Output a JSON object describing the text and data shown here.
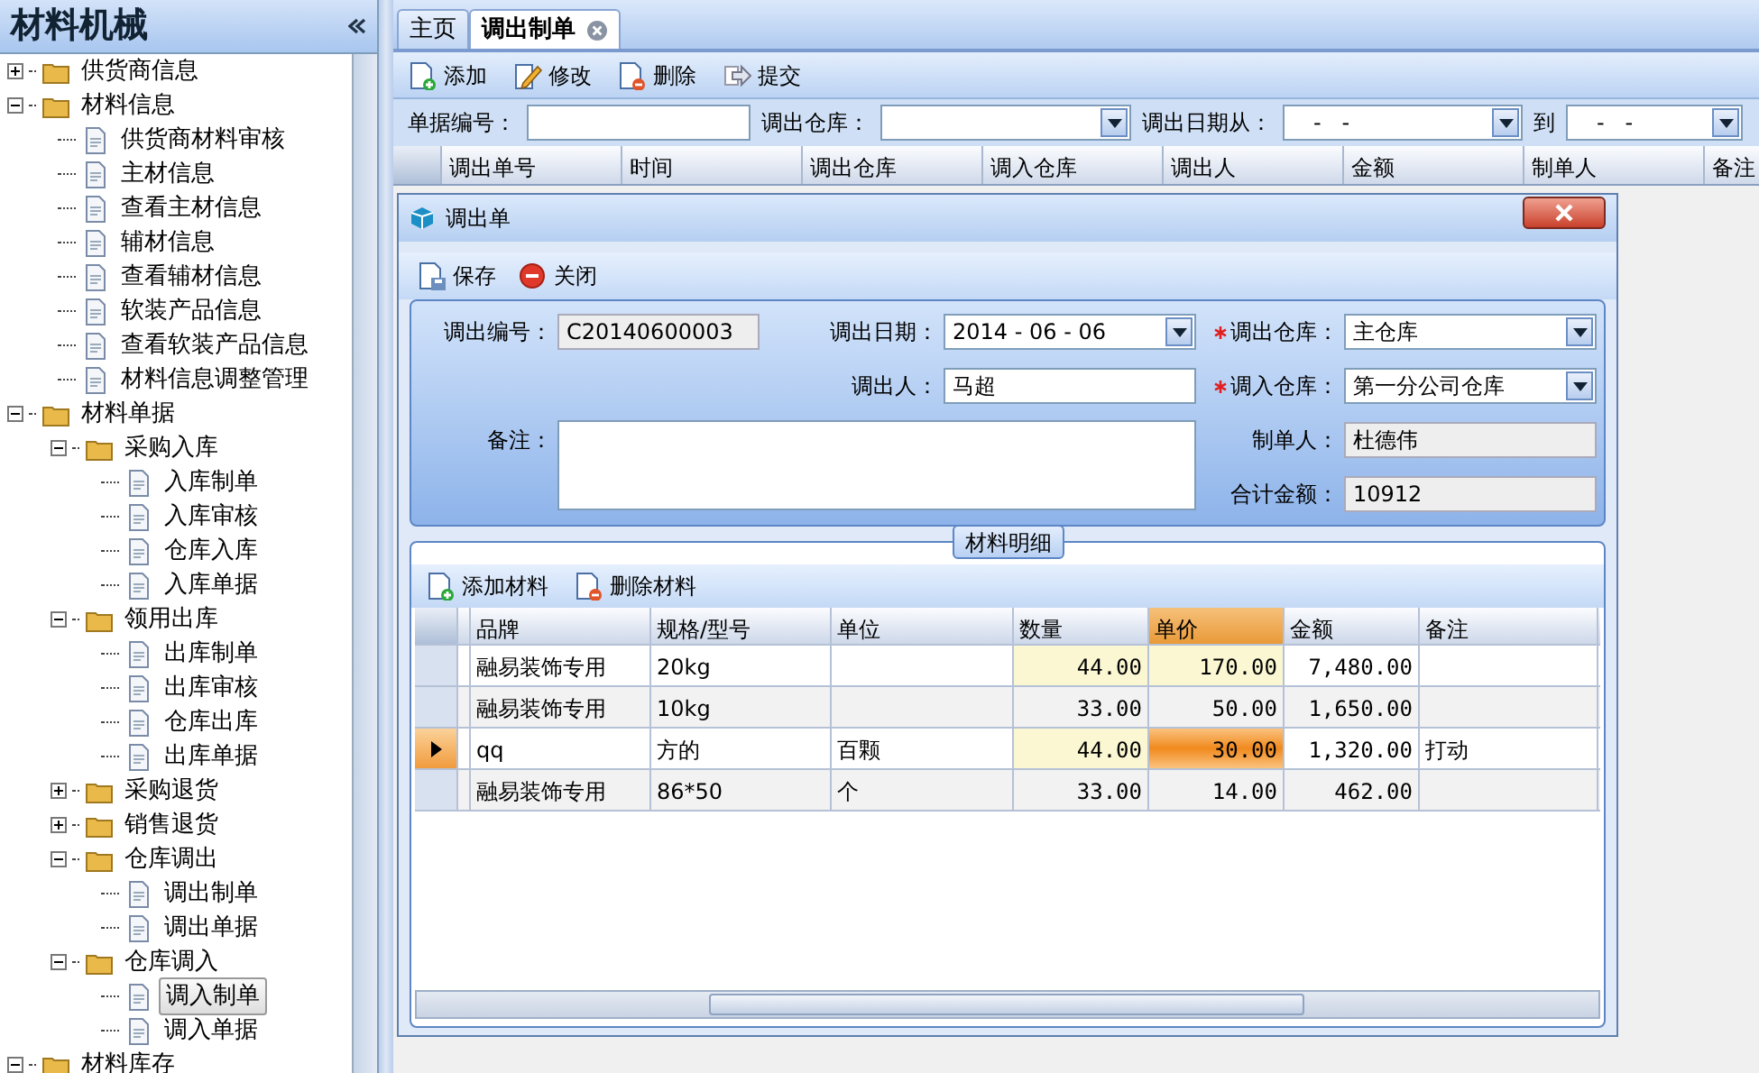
{
  "sidebar": {
    "title": "材料机械",
    "tree": [
      {
        "label": "供货商信息",
        "expanded": false,
        "selected": false
      },
      {
        "label": "材料信息",
        "expanded": true,
        "selected": false,
        "children": [
          {
            "label": "供货商材料审核",
            "selected": false
          },
          {
            "label": "主材信息",
            "selected": false
          },
          {
            "label": "查看主材信息",
            "selected": false
          },
          {
            "label": "辅材信息",
            "selected": false
          },
          {
            "label": "查看辅材信息",
            "selected": false
          },
          {
            "label": "软装产品信息",
            "selected": false
          },
          {
            "label": "查看软装产品信息",
            "selected": false
          },
          {
            "label": "材料信息调整管理",
            "selected": false
          }
        ]
      },
      {
        "label": "材料单据",
        "expanded": true,
        "selected": false,
        "children": [
          {
            "label": "采购入库",
            "expanded": true,
            "selected": false,
            "children": [
              {
                "label": "入库制单",
                "selected": false
              },
              {
                "label": "入库审核",
                "selected": false
              },
              {
                "label": "仓库入库",
                "selected": false
              },
              {
                "label": "入库单据",
                "selected": false
              }
            ]
          },
          {
            "label": "领用出库",
            "expanded": true,
            "selected": false,
            "children": [
              {
                "label": "出库制单",
                "selected": false
              },
              {
                "label": "出库审核",
                "selected": false
              },
              {
                "label": "仓库出库",
                "selected": false
              },
              {
                "label": "出库单据",
                "selected": false
              }
            ]
          },
          {
            "label": "采购退货",
            "expanded": false,
            "selected": false
          },
          {
            "label": "销售退货",
            "expanded": false,
            "selected": false
          },
          {
            "label": "仓库调出",
            "expanded": true,
            "selected": false,
            "children": [
              {
                "label": "调出制单",
                "selected": false
              },
              {
                "label": "调出单据",
                "selected": false
              }
            ]
          },
          {
            "label": "仓库调入",
            "expanded": true,
            "selected": false,
            "children": [
              {
                "label": "调入制单",
                "selected": true
              },
              {
                "label": "调入单据",
                "selected": false
              }
            ]
          }
        ]
      },
      {
        "label": "材料库存",
        "expanded": true,
        "selected": false
      }
    ]
  },
  "tabs": [
    {
      "label": "主页",
      "selected": false,
      "closable": false
    },
    {
      "label": "调出制单",
      "selected": true,
      "closable": true
    }
  ],
  "toolbar": [
    {
      "label": "添加",
      "kind": "add"
    },
    {
      "label": "修改",
      "kind": "edit"
    },
    {
      "label": "删除",
      "kind": "delete"
    },
    {
      "label": "提交",
      "kind": "submit"
    }
  ],
  "filters": [
    {
      "label": "单据编号：",
      "kind": "text"
    },
    {
      "label": "调出仓库：",
      "kind": "select"
    },
    {
      "label": "调出日期从：",
      "kind": "date",
      "value": "-   -"
    },
    {
      "label": "到",
      "kind": "date",
      "value": "-   -"
    }
  ],
  "list_columns": [
    "调出单号",
    "时间",
    "调出仓库",
    "调入仓库",
    "调出人",
    "金额",
    "制单人",
    "备注"
  ],
  "dialog": {
    "title": "调出单",
    "toolbar": [
      {
        "label": "保存",
        "kind": "save"
      },
      {
        "label": "关闭",
        "kind": "close"
      }
    ],
    "fields": {
      "number": {
        "label": "调出编号：",
        "value": "C20140600003"
      },
      "date": {
        "label": "调出日期：",
        "value": "2014 - 06 - 06"
      },
      "from": {
        "label": "调出仓库：",
        "value": "主仓库",
        "required": true
      },
      "person": {
        "label": "调出人：",
        "value": "马超"
      },
      "to": {
        "label": "调入仓库：",
        "value": "第一分公司仓库",
        "required": true
      },
      "note": {
        "label": "备注："
      },
      "maker": {
        "label": "制单人：",
        "value": "杜德伟"
      },
      "total": {
        "label": "合计金额：",
        "value": "10912"
      }
    },
    "details": {
      "title": "材料明细",
      "toolbar": [
        {
          "label": "添加材料",
          "kind": "add"
        },
        {
          "label": "删除材料",
          "kind": "delete"
        }
      ],
      "columns": [
        {
          "label": "品牌",
          "kind": "text",
          "editable": false,
          "focused": false
        },
        {
          "label": "规格/型号",
          "kind": "text",
          "editable": false,
          "focused": false
        },
        {
          "label": "单位",
          "kind": "text",
          "editable": false,
          "focused": false
        },
        {
          "label": "数量",
          "kind": "number",
          "editable": true,
          "focused": false
        },
        {
          "label": "单价",
          "kind": "number",
          "editable": true,
          "focused": true
        },
        {
          "label": "金额",
          "kind": "number",
          "editable": false,
          "focused": false
        },
        {
          "label": "备注",
          "kind": "text",
          "editable": false,
          "focused": false
        }
      ],
      "rows": [
        {
          "selected": false,
          "cells": [
            "融易装饰专用",
            "20kg",
            "",
            "44.00",
            "170.00",
            "7,480.00",
            ""
          ]
        },
        {
          "selected": false,
          "cells": [
            "融易装饰专用",
            "10kg",
            "",
            "33.00",
            "50.00",
            "1,650.00",
            ""
          ]
        },
        {
          "selected": true,
          "cells": [
            "qq",
            "方的",
            "百颗",
            "44.00",
            "30.00",
            "1,320.00",
            "打动"
          ]
        },
        {
          "selected": false,
          "cells": [
            "融易装饰专用",
            "86*50",
            "个",
            "33.00",
            "14.00",
            "462.00",
            ""
          ]
        }
      ]
    }
  }
}
